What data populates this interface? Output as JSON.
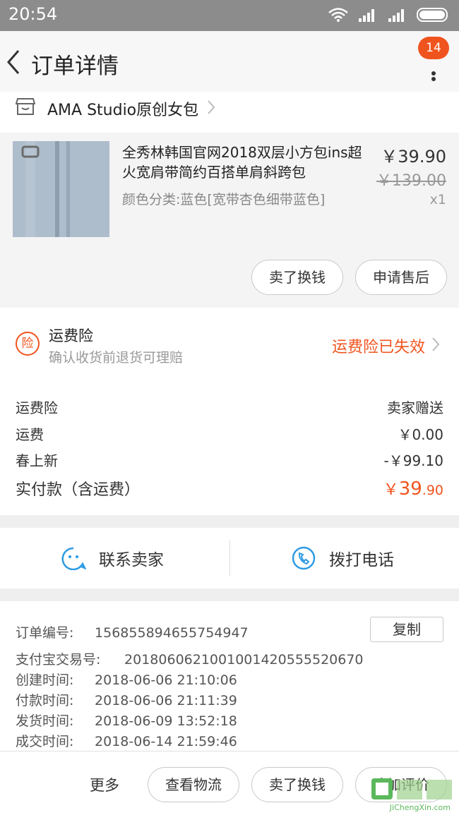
{
  "status_bar": {
    "time": "20:54"
  },
  "header": {
    "title": "订单详情",
    "badge": "14"
  },
  "shop": {
    "name": "AMA Studio原创女包"
  },
  "item": {
    "name": "全秀林韩国官网2018双层小方包ins超火宽肩带简约百搭单肩斜跨包",
    "spec": "颜色分类:蓝色[宽带杏色细带蓝色]",
    "price": "￥39.90",
    "original_price": "￥139.00",
    "quantity": "x1",
    "sell_button": "卖了换钱",
    "aftersale_button": "申请售后"
  },
  "insurance": {
    "title": "运费险",
    "subtitle": "确认收货前退货可理赔",
    "status": "运费险已失效",
    "icon_text": "险"
  },
  "costs": {
    "rows": [
      {
        "label": "运费险",
        "value": "卖家赠送"
      },
      {
        "label": "运费",
        "value": "￥0.00"
      },
      {
        "label": "春上新",
        "value": "-￥99.10"
      }
    ],
    "total_label": "实付款（含运费）",
    "total_currency": "￥",
    "total_int": "39",
    "total_dec": ".90"
  },
  "contact": {
    "seller": "联系卖家",
    "call": "拨打电话"
  },
  "order_info": {
    "copy_button": "复制",
    "rows": [
      {
        "label": "订单编号:",
        "value": "156855894655754947"
      },
      {
        "label": "支付宝交易号:",
        "value": "2018060621001001420555520670"
      },
      {
        "label": "创建时间:",
        "value": "2018-06-06 21:10:06"
      },
      {
        "label": "付款时间:",
        "value": "2018-06-06 21:11:39"
      },
      {
        "label": "发货时间:",
        "value": "2018-06-09 13:52:18"
      },
      {
        "label": "成交时间:",
        "value": "2018-06-14 21:59:46"
      }
    ]
  },
  "bottom_bar": {
    "more": "更多",
    "logistics": "查看物流",
    "sell": "卖了换钱",
    "review": "追加评价"
  },
  "watermark": {
    "domain": "JiChengXin.com"
  },
  "colors": {
    "accent": "#f0541e",
    "blue_icon": "#2e9be3"
  }
}
